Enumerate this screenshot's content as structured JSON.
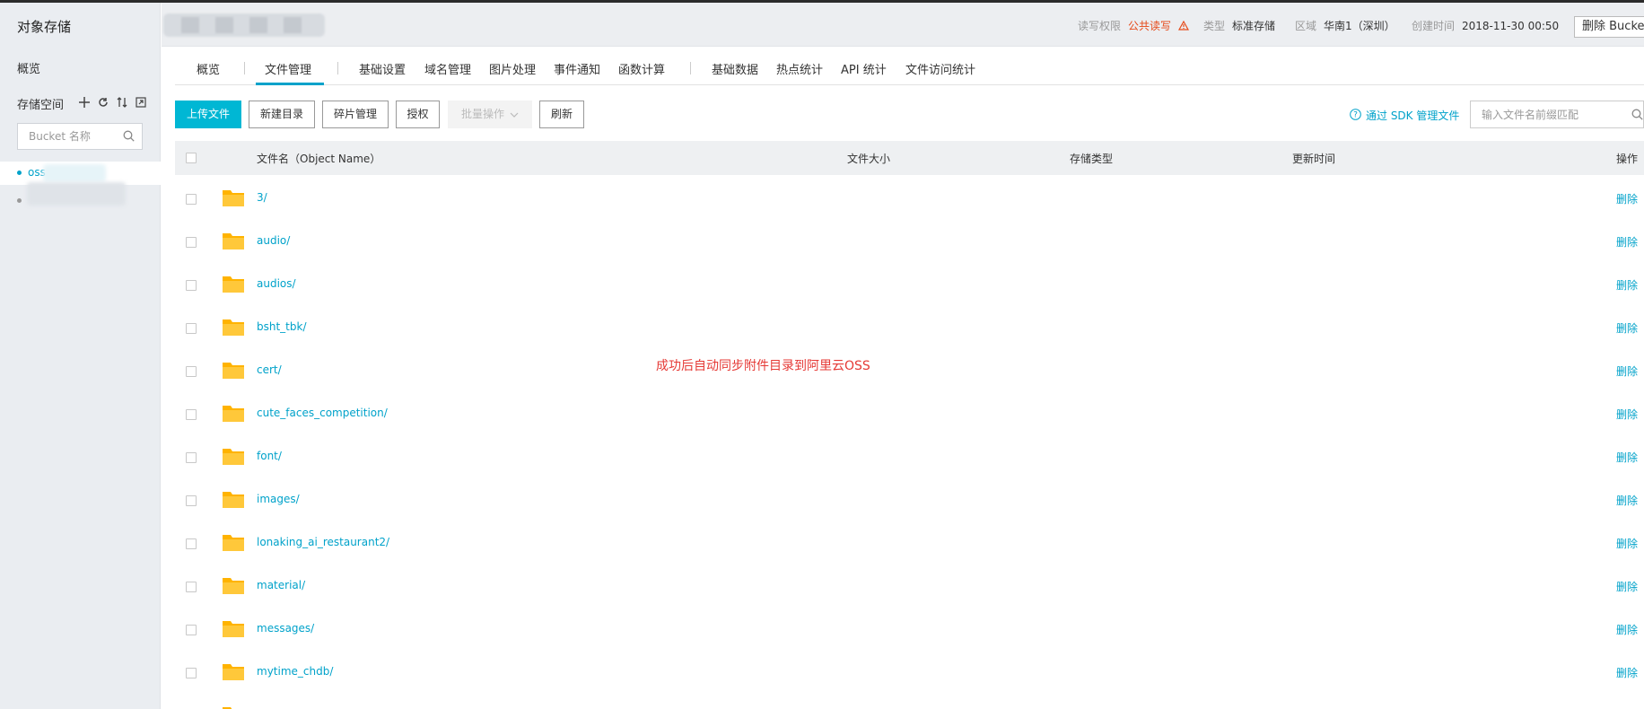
{
  "sidebar": {
    "title": "对象存储",
    "overview": "概览",
    "storage_space": "存储空间",
    "search_placeholder": "Bucket 名称",
    "active_bucket_prefix": "oss"
  },
  "header": {
    "rw_label": "读写权限",
    "rw_value": "公共读写",
    "type_label": "类型",
    "type_value": "标准存储",
    "region_label": "区域",
    "region_value": "华南1（深圳）",
    "created_label": "创建时间",
    "created_value": "2018-11-30 00:50",
    "delete_bucket": "删除 Bucket"
  },
  "tabs": [
    {
      "label": "概览"
    },
    {
      "label": "文件管理"
    },
    {
      "label": "基础设置"
    },
    {
      "label": "域名管理"
    },
    {
      "label": "图片处理"
    },
    {
      "label": "事件通知"
    },
    {
      "label": "函数计算"
    },
    {
      "label": "基础数据"
    },
    {
      "label": "热点统计"
    },
    {
      "label": "API 统计"
    },
    {
      "label": "文件访问统计"
    }
  ],
  "toolbar": {
    "upload": "上传文件",
    "new_dir": "新建目录",
    "fragments": "碎片管理",
    "authorize": "授权",
    "batch": "批量操作",
    "refresh": "刷新",
    "sdk_link": "通过 SDK 管理文件",
    "search_placeholder": "输入文件名前缀匹配"
  },
  "table": {
    "columns": {
      "name": "文件名（Object Name）",
      "size": "文件大小",
      "storage": "存储类型",
      "updated": "更新时间",
      "actions": "操作"
    },
    "rows": [
      {
        "name": "3/",
        "action": "删除"
      },
      {
        "name": "audio/",
        "action": "删除"
      },
      {
        "name": "audios/",
        "action": "删除"
      },
      {
        "name": "bsht_tbk/",
        "action": "删除"
      },
      {
        "name": "cert/",
        "action": "删除"
      },
      {
        "name": "cute_faces_competition/",
        "action": "删除"
      },
      {
        "name": "font/",
        "action": "删除"
      },
      {
        "name": "images/",
        "action": "删除"
      },
      {
        "name": "lonaking_ai_restaurant2/",
        "action": "删除"
      },
      {
        "name": "material/",
        "action": "删除"
      },
      {
        "name": "messages/",
        "action": "删除"
      },
      {
        "name": "mytime_chdb/",
        "action": "删除"
      }
    ]
  },
  "annotation": "成功后自动同步附件目录到阿里云OSS",
  "colors": {
    "accent": "#00a2ca",
    "primary_button": "#00b7d4",
    "folder": "#ffc107",
    "warning": "#e64a19",
    "annotation": "#e53935"
  }
}
